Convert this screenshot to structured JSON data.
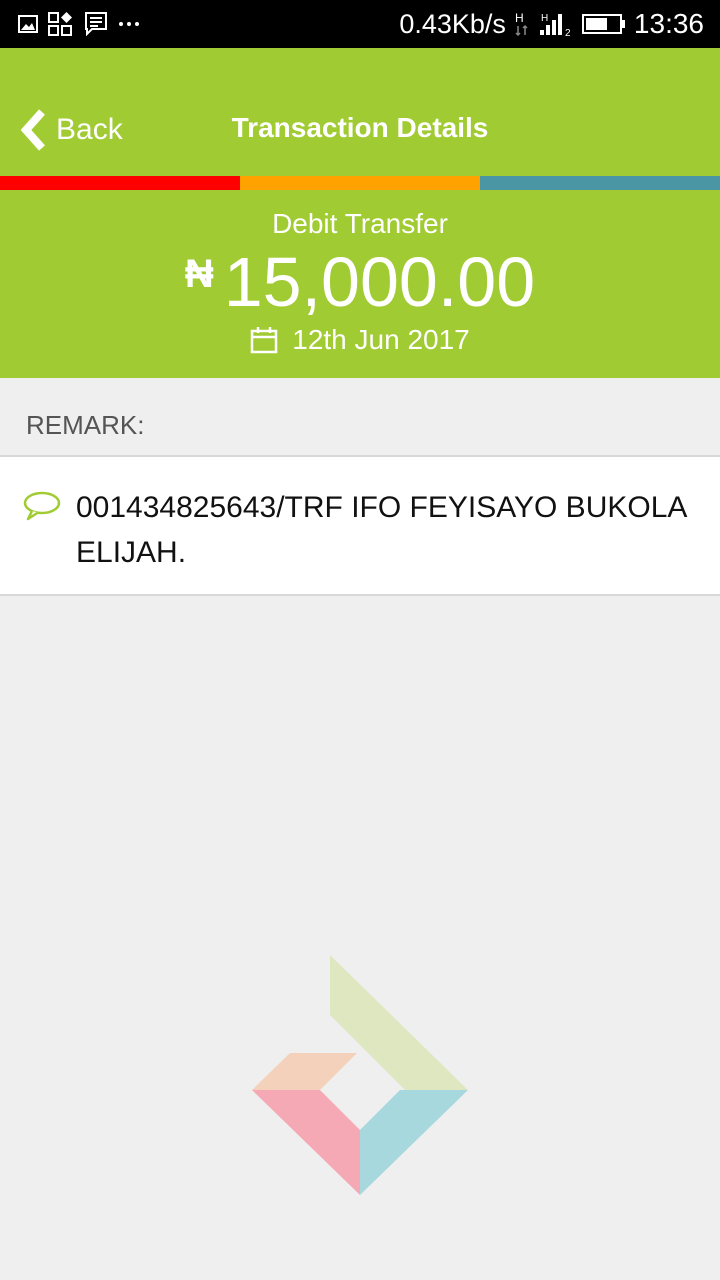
{
  "status_bar": {
    "left_icons": [
      "image-icon",
      "apps-icon",
      "message-icon",
      "more-icon"
    ],
    "speed": "0.43Kb/s",
    "time": "13:36",
    "right_icons": [
      "network-h-icon",
      "signal-icon",
      "battery-icon"
    ]
  },
  "header": {
    "back_label": "Back",
    "title": "Transaction Details",
    "color": "#a0cb32",
    "stripe_colors": [
      "#ff0000",
      "#ffa200",
      "#4a96a4"
    ]
  },
  "transaction": {
    "type": "Debit Transfer",
    "currency": "₦",
    "amount": "15,000.00",
    "date": "12th Jun 2017",
    "date_icon": "calendar-icon"
  },
  "remark": {
    "heading": "REMARK:",
    "icon": "speech-bubble-icon",
    "text": "001434825643/TRF IFO FEYISAYO BUKOLA ELIJAH."
  },
  "logo": {
    "colors": [
      "#dfe7c1",
      "#f4d1bb",
      "#f4a9b4",
      "#a7d8dd"
    ]
  }
}
